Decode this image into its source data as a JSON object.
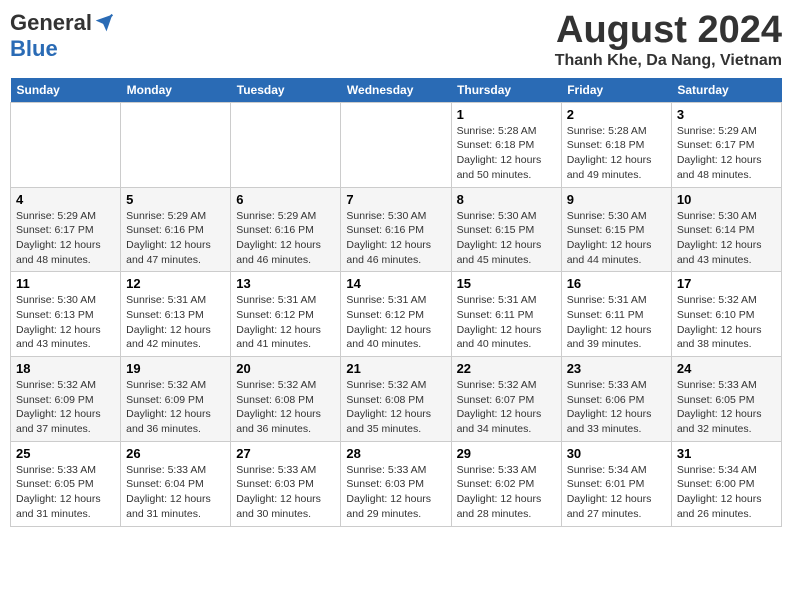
{
  "header": {
    "logo_general": "General",
    "logo_blue": "Blue",
    "month_year": "August 2024",
    "location": "Thanh Khe, Da Nang, Vietnam"
  },
  "weekdays": [
    "Sunday",
    "Monday",
    "Tuesday",
    "Wednesday",
    "Thursday",
    "Friday",
    "Saturday"
  ],
  "weeks": [
    [
      {
        "day": "",
        "info": ""
      },
      {
        "day": "",
        "info": ""
      },
      {
        "day": "",
        "info": ""
      },
      {
        "day": "",
        "info": ""
      },
      {
        "day": "1",
        "info": "Sunrise: 5:28 AM\nSunset: 6:18 PM\nDaylight: 12 hours\nand 50 minutes."
      },
      {
        "day": "2",
        "info": "Sunrise: 5:28 AM\nSunset: 6:18 PM\nDaylight: 12 hours\nand 49 minutes."
      },
      {
        "day": "3",
        "info": "Sunrise: 5:29 AM\nSunset: 6:17 PM\nDaylight: 12 hours\nand 48 minutes."
      }
    ],
    [
      {
        "day": "4",
        "info": "Sunrise: 5:29 AM\nSunset: 6:17 PM\nDaylight: 12 hours\nand 48 minutes."
      },
      {
        "day": "5",
        "info": "Sunrise: 5:29 AM\nSunset: 6:16 PM\nDaylight: 12 hours\nand 47 minutes."
      },
      {
        "day": "6",
        "info": "Sunrise: 5:29 AM\nSunset: 6:16 PM\nDaylight: 12 hours\nand 46 minutes."
      },
      {
        "day": "7",
        "info": "Sunrise: 5:30 AM\nSunset: 6:16 PM\nDaylight: 12 hours\nand 46 minutes."
      },
      {
        "day": "8",
        "info": "Sunrise: 5:30 AM\nSunset: 6:15 PM\nDaylight: 12 hours\nand 45 minutes."
      },
      {
        "day": "9",
        "info": "Sunrise: 5:30 AM\nSunset: 6:15 PM\nDaylight: 12 hours\nand 44 minutes."
      },
      {
        "day": "10",
        "info": "Sunrise: 5:30 AM\nSunset: 6:14 PM\nDaylight: 12 hours\nand 43 minutes."
      }
    ],
    [
      {
        "day": "11",
        "info": "Sunrise: 5:30 AM\nSunset: 6:13 PM\nDaylight: 12 hours\nand 43 minutes."
      },
      {
        "day": "12",
        "info": "Sunrise: 5:31 AM\nSunset: 6:13 PM\nDaylight: 12 hours\nand 42 minutes."
      },
      {
        "day": "13",
        "info": "Sunrise: 5:31 AM\nSunset: 6:12 PM\nDaylight: 12 hours\nand 41 minutes."
      },
      {
        "day": "14",
        "info": "Sunrise: 5:31 AM\nSunset: 6:12 PM\nDaylight: 12 hours\nand 40 minutes."
      },
      {
        "day": "15",
        "info": "Sunrise: 5:31 AM\nSunset: 6:11 PM\nDaylight: 12 hours\nand 40 minutes."
      },
      {
        "day": "16",
        "info": "Sunrise: 5:31 AM\nSunset: 6:11 PM\nDaylight: 12 hours\nand 39 minutes."
      },
      {
        "day": "17",
        "info": "Sunrise: 5:32 AM\nSunset: 6:10 PM\nDaylight: 12 hours\nand 38 minutes."
      }
    ],
    [
      {
        "day": "18",
        "info": "Sunrise: 5:32 AM\nSunset: 6:09 PM\nDaylight: 12 hours\nand 37 minutes."
      },
      {
        "day": "19",
        "info": "Sunrise: 5:32 AM\nSunset: 6:09 PM\nDaylight: 12 hours\nand 36 minutes."
      },
      {
        "day": "20",
        "info": "Sunrise: 5:32 AM\nSunset: 6:08 PM\nDaylight: 12 hours\nand 36 minutes."
      },
      {
        "day": "21",
        "info": "Sunrise: 5:32 AM\nSunset: 6:08 PM\nDaylight: 12 hours\nand 35 minutes."
      },
      {
        "day": "22",
        "info": "Sunrise: 5:32 AM\nSunset: 6:07 PM\nDaylight: 12 hours\nand 34 minutes."
      },
      {
        "day": "23",
        "info": "Sunrise: 5:33 AM\nSunset: 6:06 PM\nDaylight: 12 hours\nand 33 minutes."
      },
      {
        "day": "24",
        "info": "Sunrise: 5:33 AM\nSunset: 6:05 PM\nDaylight: 12 hours\nand 32 minutes."
      }
    ],
    [
      {
        "day": "25",
        "info": "Sunrise: 5:33 AM\nSunset: 6:05 PM\nDaylight: 12 hours\nand 31 minutes."
      },
      {
        "day": "26",
        "info": "Sunrise: 5:33 AM\nSunset: 6:04 PM\nDaylight: 12 hours\nand 31 minutes."
      },
      {
        "day": "27",
        "info": "Sunrise: 5:33 AM\nSunset: 6:03 PM\nDaylight: 12 hours\nand 30 minutes."
      },
      {
        "day": "28",
        "info": "Sunrise: 5:33 AM\nSunset: 6:03 PM\nDaylight: 12 hours\nand 29 minutes."
      },
      {
        "day": "29",
        "info": "Sunrise: 5:33 AM\nSunset: 6:02 PM\nDaylight: 12 hours\nand 28 minutes."
      },
      {
        "day": "30",
        "info": "Sunrise: 5:34 AM\nSunset: 6:01 PM\nDaylight: 12 hours\nand 27 minutes."
      },
      {
        "day": "31",
        "info": "Sunrise: 5:34 AM\nSunset: 6:00 PM\nDaylight: 12 hours\nand 26 minutes."
      }
    ]
  ]
}
